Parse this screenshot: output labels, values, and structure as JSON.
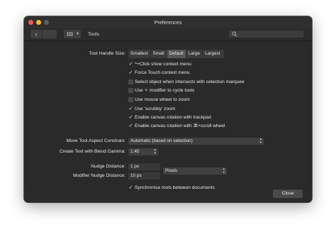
{
  "window": {
    "title": "Preferences"
  },
  "toolbar": {
    "back_glyph": "‹",
    "section": "Tools",
    "icons": {
      "grid": "grid-icon",
      "search": "search-icon"
    }
  },
  "tools": {
    "handle_size": {
      "label": "Tool Handle Size:",
      "options": [
        "Smallest",
        "Small",
        "Default",
        "Large",
        "Largest"
      ],
      "selected": "Default"
    },
    "checks": [
      {
        "label": "^+Click show context menu",
        "checked": true
      },
      {
        "label": "Force Touch context menu",
        "checked": true
      },
      {
        "label": "Select object when intersects with selection marquee",
        "checked": false
      },
      {
        "label": "Use ✧ modifier to cycle tools",
        "checked": false
      },
      {
        "label": "Use mouse wheel to zoom",
        "checked": false
      },
      {
        "label": "Use 'scrubby' zoom",
        "checked": true
      },
      {
        "label": "Enable canvas rotation with trackpad",
        "checked": true
      },
      {
        "label": "Enable canvas rotation with ⌘+scroll wheel",
        "checked": true
      }
    ],
    "move_aspect": {
      "label": "Move Tool Aspect Constrain:",
      "value": "Automatic (based on selection)"
    },
    "blend_gamma": {
      "label": "Create Text with Blend Gamma:",
      "value": "1.45"
    },
    "nudge": {
      "label": "Nudge Distance:",
      "value": "1 px"
    },
    "modifier_nudge": {
      "label": "Modifier Nudge Distance:",
      "value": "10 px"
    },
    "units": {
      "value": "Pixels"
    },
    "sync": {
      "label": "Synchronise tools between documents",
      "checked": true
    }
  },
  "footer": {
    "close_label": "Close"
  },
  "colors": {
    "window_bg": "#2a2a2a",
    "close_light": "#ee5c55",
    "minimize_light": "#f1bd3b",
    "control_bg": "#404040"
  }
}
